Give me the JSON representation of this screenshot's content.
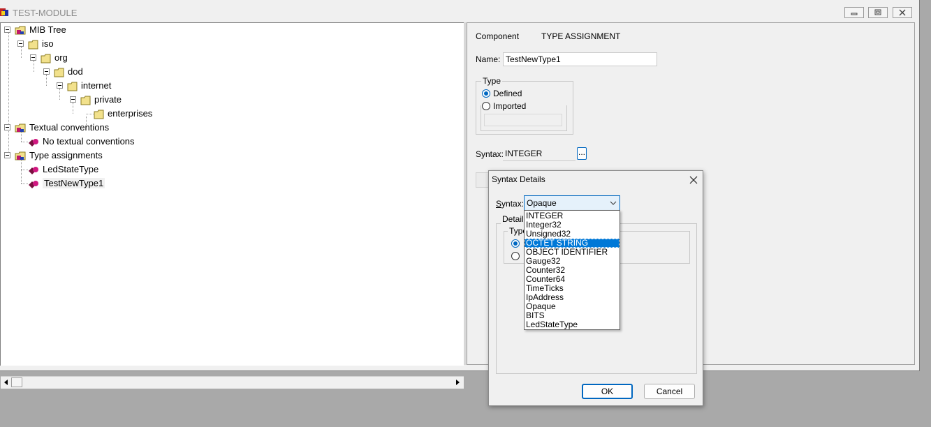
{
  "window": {
    "title": "TEST-MODULE"
  },
  "tree": {
    "nodes": [
      {
        "label": "MIB Tree",
        "kind": "root"
      },
      {
        "label": "iso",
        "kind": "folder"
      },
      {
        "label": "org",
        "kind": "folder"
      },
      {
        "label": "dod",
        "kind": "folder"
      },
      {
        "label": "internet",
        "kind": "folder"
      },
      {
        "label": "private",
        "kind": "folder"
      },
      {
        "label": "enterprises",
        "kind": "folder"
      },
      {
        "label": "Textual conventions",
        "kind": "root"
      },
      {
        "label": "No textual conventions",
        "kind": "item"
      },
      {
        "label": "Type assignments",
        "kind": "root"
      },
      {
        "label": "LedStateType",
        "kind": "item"
      },
      {
        "label": "TestNewType1",
        "kind": "item",
        "selected": true
      }
    ]
  },
  "props": {
    "component_label": "Component",
    "component_value": "TYPE ASSIGNMENT",
    "name_label": "Name:",
    "name_value": "TestNewType1",
    "type_group_label": "Type",
    "defined_label": "Defined",
    "imported_label": "Imported",
    "type_selected": "Defined",
    "syntax_label": "Syntax:",
    "syntax_value": "INTEGER",
    "browse_label": "..."
  },
  "dialog": {
    "title": "Syntax Details",
    "syntax_label": "Syntax:",
    "syntax_mnemonic": "S",
    "syntax_rest": "yntax:",
    "selected_value": "Opaque",
    "details_label": "Details",
    "type_label": "Type",
    "ok_label": "OK",
    "cancel_label": "Cancel",
    "options": [
      "INTEGER",
      "Integer32",
      "Unsigned32",
      "OCTET STRING",
      "OBJECT IDENTIFIER",
      "Gauge32",
      "Counter32",
      "Counter64",
      "TimeTicks",
      "IpAddress",
      "Opaque",
      "BITS",
      "LedStateType"
    ],
    "highlighted_option": "OCTET STRING"
  },
  "colors": {
    "accent": "#0067c0",
    "highlight": "#0078d7",
    "folder": "#f2e18c"
  }
}
